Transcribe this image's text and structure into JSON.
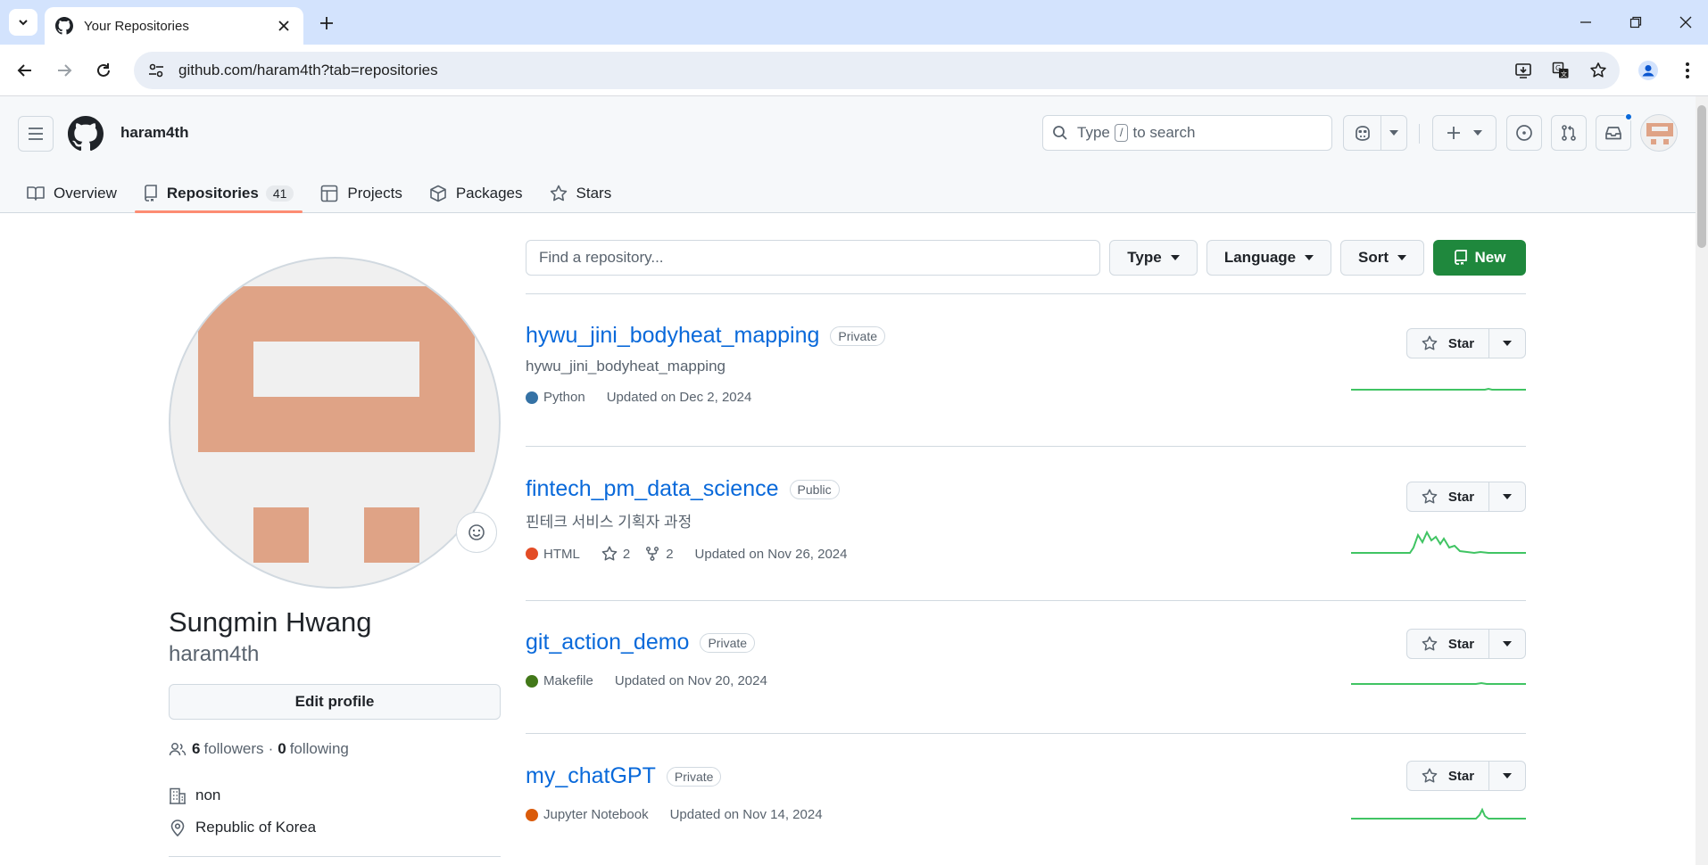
{
  "browser": {
    "tab_title": "Your Repositories",
    "url": "github.com/haram4th?tab=repositories"
  },
  "header": {
    "username": "haram4th",
    "search_prefix": "Type",
    "search_key": "/",
    "search_suffix": "to search"
  },
  "profile_tabs": {
    "overview": "Overview",
    "repositories": "Repositories",
    "repositories_count": "41",
    "projects": "Projects",
    "packages": "Packages",
    "stars": "Stars"
  },
  "profile": {
    "full_name": "Sungmin Hwang",
    "login": "haram4th",
    "edit_label": "Edit profile",
    "followers_count": "6",
    "followers_label": "followers",
    "separator": "·",
    "following_count": "0",
    "following_label": "following",
    "company": "non",
    "location": "Republic of Korea"
  },
  "repo_filters": {
    "search_placeholder": "Find a repository...",
    "type_label": "Type",
    "language_label": "Language",
    "sort_label": "Sort",
    "new_label": "New"
  },
  "repos": [
    {
      "name": "hywu_jini_bodyheat_mapping",
      "visibility": "Private",
      "description": "hywu_jini_bodyheat_mapping",
      "language": "Python",
      "language_color": "#3572A5",
      "updated": "Updated on Dec 2, 2024",
      "star_label": "Star"
    },
    {
      "name": "fintech_pm_data_science",
      "visibility": "Public",
      "description": "핀테크 서비스 기획자 과정",
      "language": "HTML",
      "language_color": "#e34c26",
      "stars": "2",
      "forks": "2",
      "updated": "Updated on Nov 26, 2024",
      "star_label": "Star"
    },
    {
      "name": "git_action_demo",
      "visibility": "Private",
      "language": "Makefile",
      "language_color": "#427819",
      "updated": "Updated on Nov 20, 2024",
      "star_label": "Star"
    },
    {
      "name": "my_chatGPT",
      "visibility": "Private",
      "language": "Jupyter Notebook",
      "language_color": "#DA5B0B",
      "updated": "Updated on Nov 14, 2024",
      "star_label": "Star"
    }
  ],
  "colors": {
    "link": "#0969da",
    "new_button": "#1f883d",
    "selected_tab_underline": "#fd8c73",
    "avatar_identicon": "#dfa386",
    "sparkline": "#40c463"
  }
}
